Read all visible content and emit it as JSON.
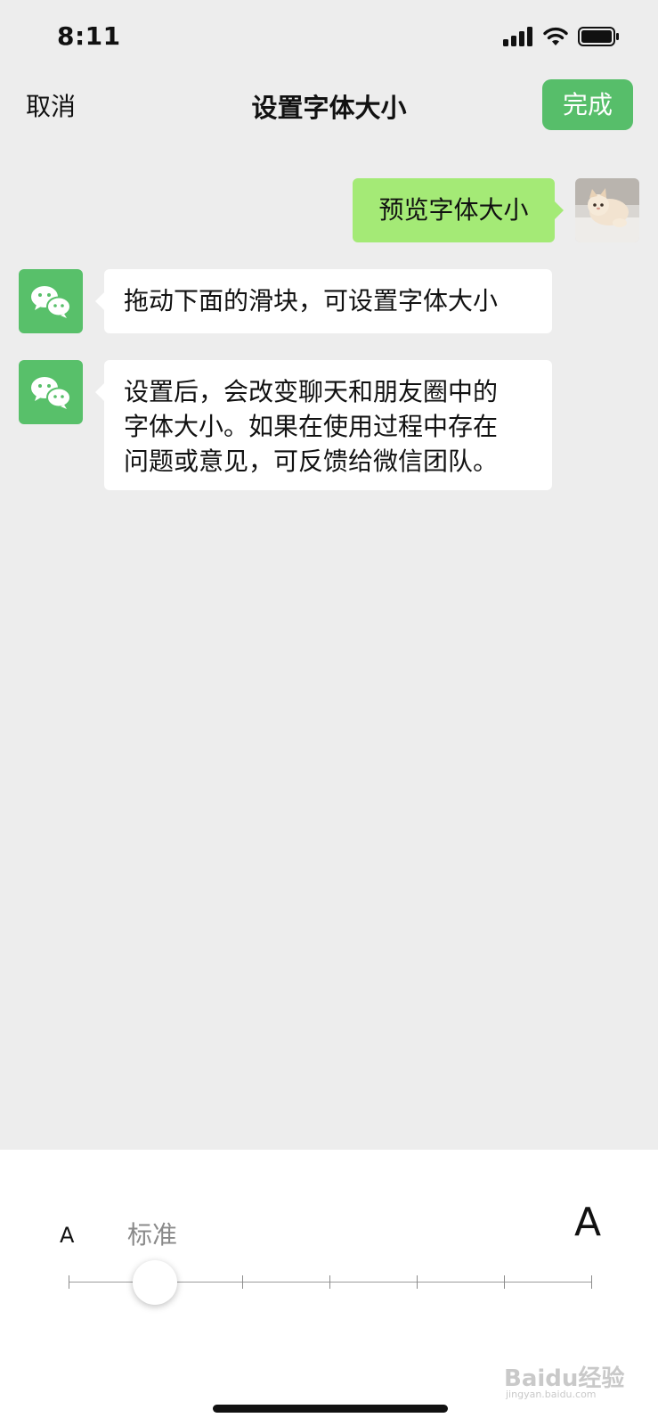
{
  "status_bar": {
    "time": "8:11"
  },
  "nav": {
    "cancel_label": "取消",
    "title": "设置字体大小",
    "done_label": "完成"
  },
  "messages": [
    {
      "side": "right",
      "text": "预览字体大小"
    },
    {
      "side": "left",
      "text": "拖动下面的滑块，可设置字体大小"
    },
    {
      "side": "left",
      "lines": [
        "设置后，会改变聊天和朋友圈中的",
        "字体大小。如果在使用过程中存在",
        "问题或意见，可反馈给微信团队。"
      ]
    }
  ],
  "font_size_panel": {
    "small_a": "A",
    "large_a": "A",
    "current_label": "标准",
    "levels": 7,
    "selected_index": 1
  },
  "watermark": {
    "brand": "Baidu经验",
    "url": "jingyan.baidu.com"
  },
  "colors": {
    "accent_green": "#57be6a",
    "bubble_green": "#a4ea76",
    "background": "#ededed"
  }
}
